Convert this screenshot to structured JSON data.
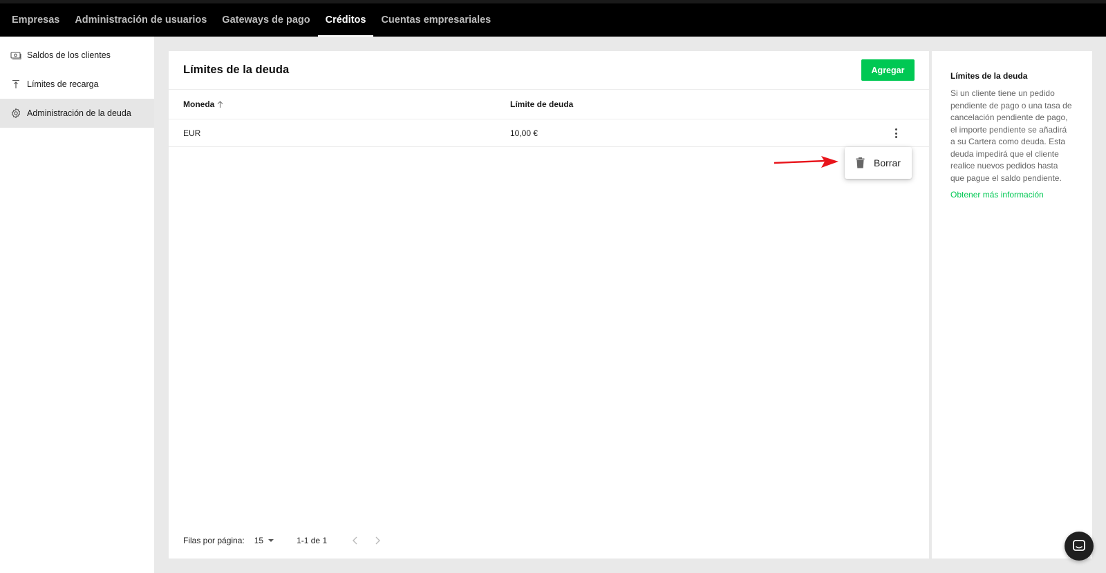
{
  "topnav": {
    "tabs": [
      {
        "label": "Empresas"
      },
      {
        "label": "Administración de usuarios"
      },
      {
        "label": "Gateways de pago"
      },
      {
        "label": "Créditos"
      },
      {
        "label": "Cuentas empresariales"
      }
    ],
    "active_index": 3
  },
  "sidebar": {
    "items": [
      {
        "label": "Saldos de los clientes",
        "icon": "money-icon"
      },
      {
        "label": "Límites de recarga",
        "icon": "upload-limit-icon"
      },
      {
        "label": "Administración de la deuda",
        "icon": "gear-icon"
      }
    ],
    "active_index": 2
  },
  "main": {
    "title": "Límites de la deuda",
    "add_label": "Agregar",
    "columns": [
      "Moneda",
      "Límite de deuda"
    ],
    "rows": [
      {
        "currency": "EUR",
        "limit": "10,00 €"
      }
    ],
    "menu": {
      "delete_label": "Borrar"
    },
    "pagination": {
      "rows_per_page_label": "Filas por página:",
      "rows_per_page": "15",
      "range": "1-1 de 1"
    }
  },
  "info_panel": {
    "title": "Límites de la deuda",
    "body": "Si un cliente tiene un pedido pendiente de pago o una tasa de cancelación pendiente de pago, el importe pendiente se añadirá a su Cartera como deuda. Esta deuda impedirá que el cliente realice nuevos pedidos hasta que pague el saldo pendiente.",
    "link": "Obtener más información"
  },
  "colors": {
    "accent": "#00c853",
    "topbar": "#000000",
    "annotation_arrow": "#e8141b"
  }
}
